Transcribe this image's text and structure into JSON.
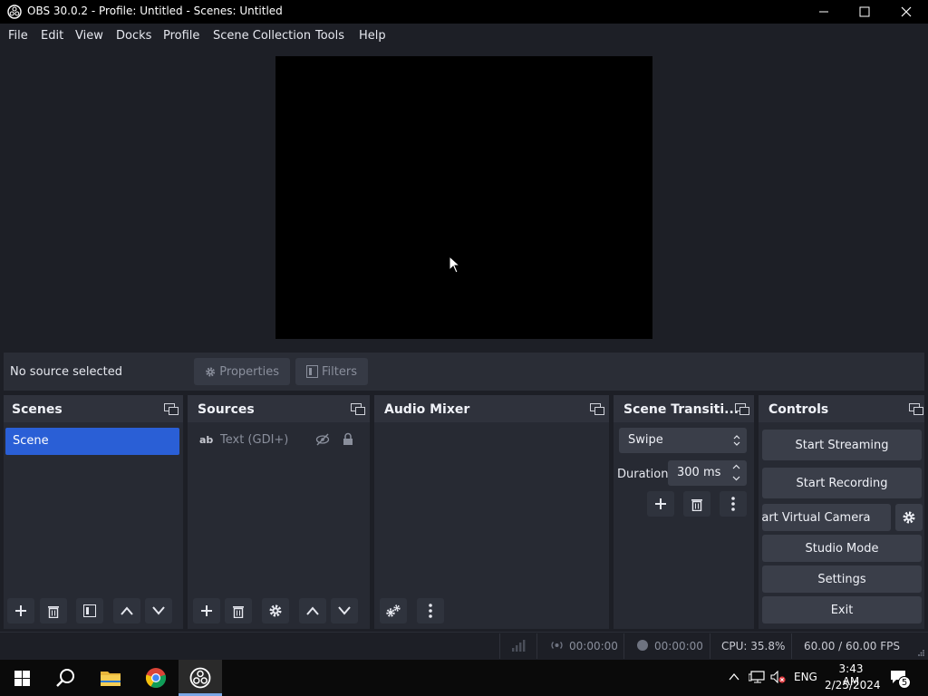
{
  "window": {
    "title": "OBS 30.0.2 - Profile: Untitled - Scenes: Untitled"
  },
  "menu": [
    "File",
    "Edit",
    "View",
    "Docks",
    "Profile",
    "Scene Collection",
    "Tools",
    "Help"
  ],
  "context": {
    "no_source": "No source selected",
    "properties": "Properties",
    "filters": "Filters"
  },
  "scenes": {
    "title": "Scenes",
    "items": [
      "Scene"
    ]
  },
  "sources": {
    "title": "Sources",
    "items": [
      "Text (GDI+)"
    ],
    "type_badge": "ab"
  },
  "audio_mixer": {
    "title": "Audio Mixer"
  },
  "transitions": {
    "title": "Scene Transiti...",
    "selected": "Swipe",
    "duration_label": "Duration",
    "duration_value": "300 ms"
  },
  "controls": {
    "title": "Controls",
    "start_streaming": "Start Streaming",
    "start_recording": "Start Recording",
    "start_virtual_camera": "Start Virtual Camera",
    "studio_mode": "Studio Mode",
    "settings": "Settings",
    "exit": "Exit"
  },
  "status": {
    "stream_time": "00:00:00",
    "record_time": "00:00:00",
    "cpu": "CPU: 35.8%",
    "fps": "60.00 / 60.00 FPS"
  },
  "taskbar": {
    "time": "3:43 AM",
    "date": "2/25/2024",
    "lang": "ENG",
    "notifications": "5"
  },
  "colors": {
    "accent": "#2a5fd6",
    "panel": "#272a33",
    "background": "#1d1f26"
  }
}
